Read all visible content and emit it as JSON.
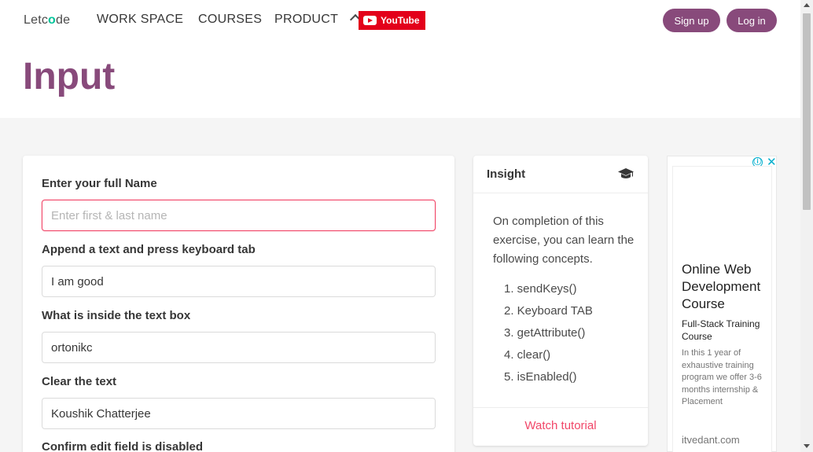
{
  "nav": {
    "logo_prefix": "Letc",
    "logo_o": "o",
    "logo_suffix": "de",
    "items": [
      "WORK SPACE",
      "COURSES",
      "PRODUCT"
    ],
    "youtube_label": "YouTube",
    "signup_label": "Sign up",
    "login_label": "Log in",
    "accent_color": "#884a7b"
  },
  "page": {
    "title": "Input"
  },
  "form": {
    "fields": [
      {
        "label": "Enter your full Name",
        "value": "",
        "placeholder": "Enter first & last name"
      },
      {
        "label": "Append a text and press keyboard tab",
        "value": "I am good",
        "placeholder": ""
      },
      {
        "label": "What is inside the text box",
        "value": "ortonikc",
        "placeholder": ""
      },
      {
        "label": "Clear the text",
        "value": "Koushik Chatterjee",
        "placeholder": ""
      }
    ],
    "disabled_label": "Confirm edit field is disabled"
  },
  "insight": {
    "title": "Insight",
    "icon": "graduation-cap-icon",
    "text": "On completion of this exercise, you can learn the following concepts.",
    "concepts": [
      "1. sendKeys()",
      "2. Keyboard TAB",
      "3. getAttribute()",
      "4. clear()",
      "5. isEnabled()"
    ],
    "watch_label": "Watch tutorial"
  },
  "ad": {
    "info_icon": "ⓘ",
    "close_icon": "✕",
    "title": "Online Web Development Course",
    "subtitle": "Full-Stack Training Course",
    "description": "In this 1 year of exhaustive training program we offer 3-6 months internship & Placement",
    "domain": "itvedant.com"
  }
}
